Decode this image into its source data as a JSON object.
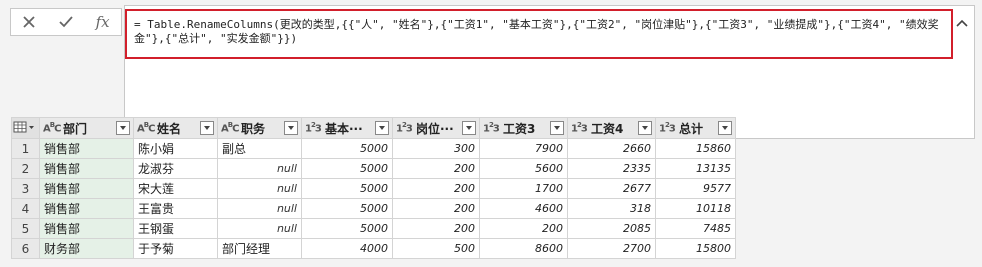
{
  "formula_bar": {
    "cancel_icon": "close-icon",
    "commit_icon": "check-icon",
    "fx_label": "fx",
    "formula": "= Table.RenameColumns(更改的类型,{{\"人\", \"姓名\"},{\"工资1\", \"基本工资\"},{\"工资2\", \"岗位津贴\"},{\"工资3\", \"业绩提成\"},{\"工资4\", \"绩效奖金\"},{\"总计\", \"实发金额\"}})"
  },
  "table": {
    "columns": [
      {
        "type": "ABC",
        "name": "部门"
      },
      {
        "type": "ABC",
        "name": "姓名"
      },
      {
        "type": "ABC",
        "name": "职务"
      },
      {
        "type": "123",
        "name": "基本···"
      },
      {
        "type": "123",
        "name": "岗位···"
      },
      {
        "type": "123",
        "name": "工资3"
      },
      {
        "type": "123",
        "name": "工资4"
      },
      {
        "type": "123",
        "name": "总计"
      }
    ],
    "rows": [
      {
        "n": "1",
        "cells": [
          "销售部",
          "陈小娟",
          "副总",
          "5000",
          "300",
          "7900",
          "2660",
          "15860"
        ]
      },
      {
        "n": "2",
        "cells": [
          "销售部",
          "龙淑芬",
          "null",
          "5000",
          "200",
          "5600",
          "2335",
          "13135"
        ]
      },
      {
        "n": "3",
        "cells": [
          "销售部",
          "宋大莲",
          "null",
          "5000",
          "200",
          "1700",
          "2677",
          "9577"
        ]
      },
      {
        "n": "4",
        "cells": [
          "销售部",
          "王富贵",
          "null",
          "5000",
          "200",
          "4600",
          "318",
          "10118"
        ]
      },
      {
        "n": "5",
        "cells": [
          "销售部",
          "王钢蛋",
          "null",
          "5000",
          "200",
          "200",
          "2085",
          "7485"
        ]
      },
      {
        "n": "6",
        "cells": [
          "财务部",
          "于予菊",
          "部门经理",
          "4000",
          "500",
          "8600",
          "2700",
          "15800"
        ]
      }
    ]
  },
  "colors": {
    "highlight_border": "#d21f2b",
    "selected_column": "#e5f1e7"
  }
}
